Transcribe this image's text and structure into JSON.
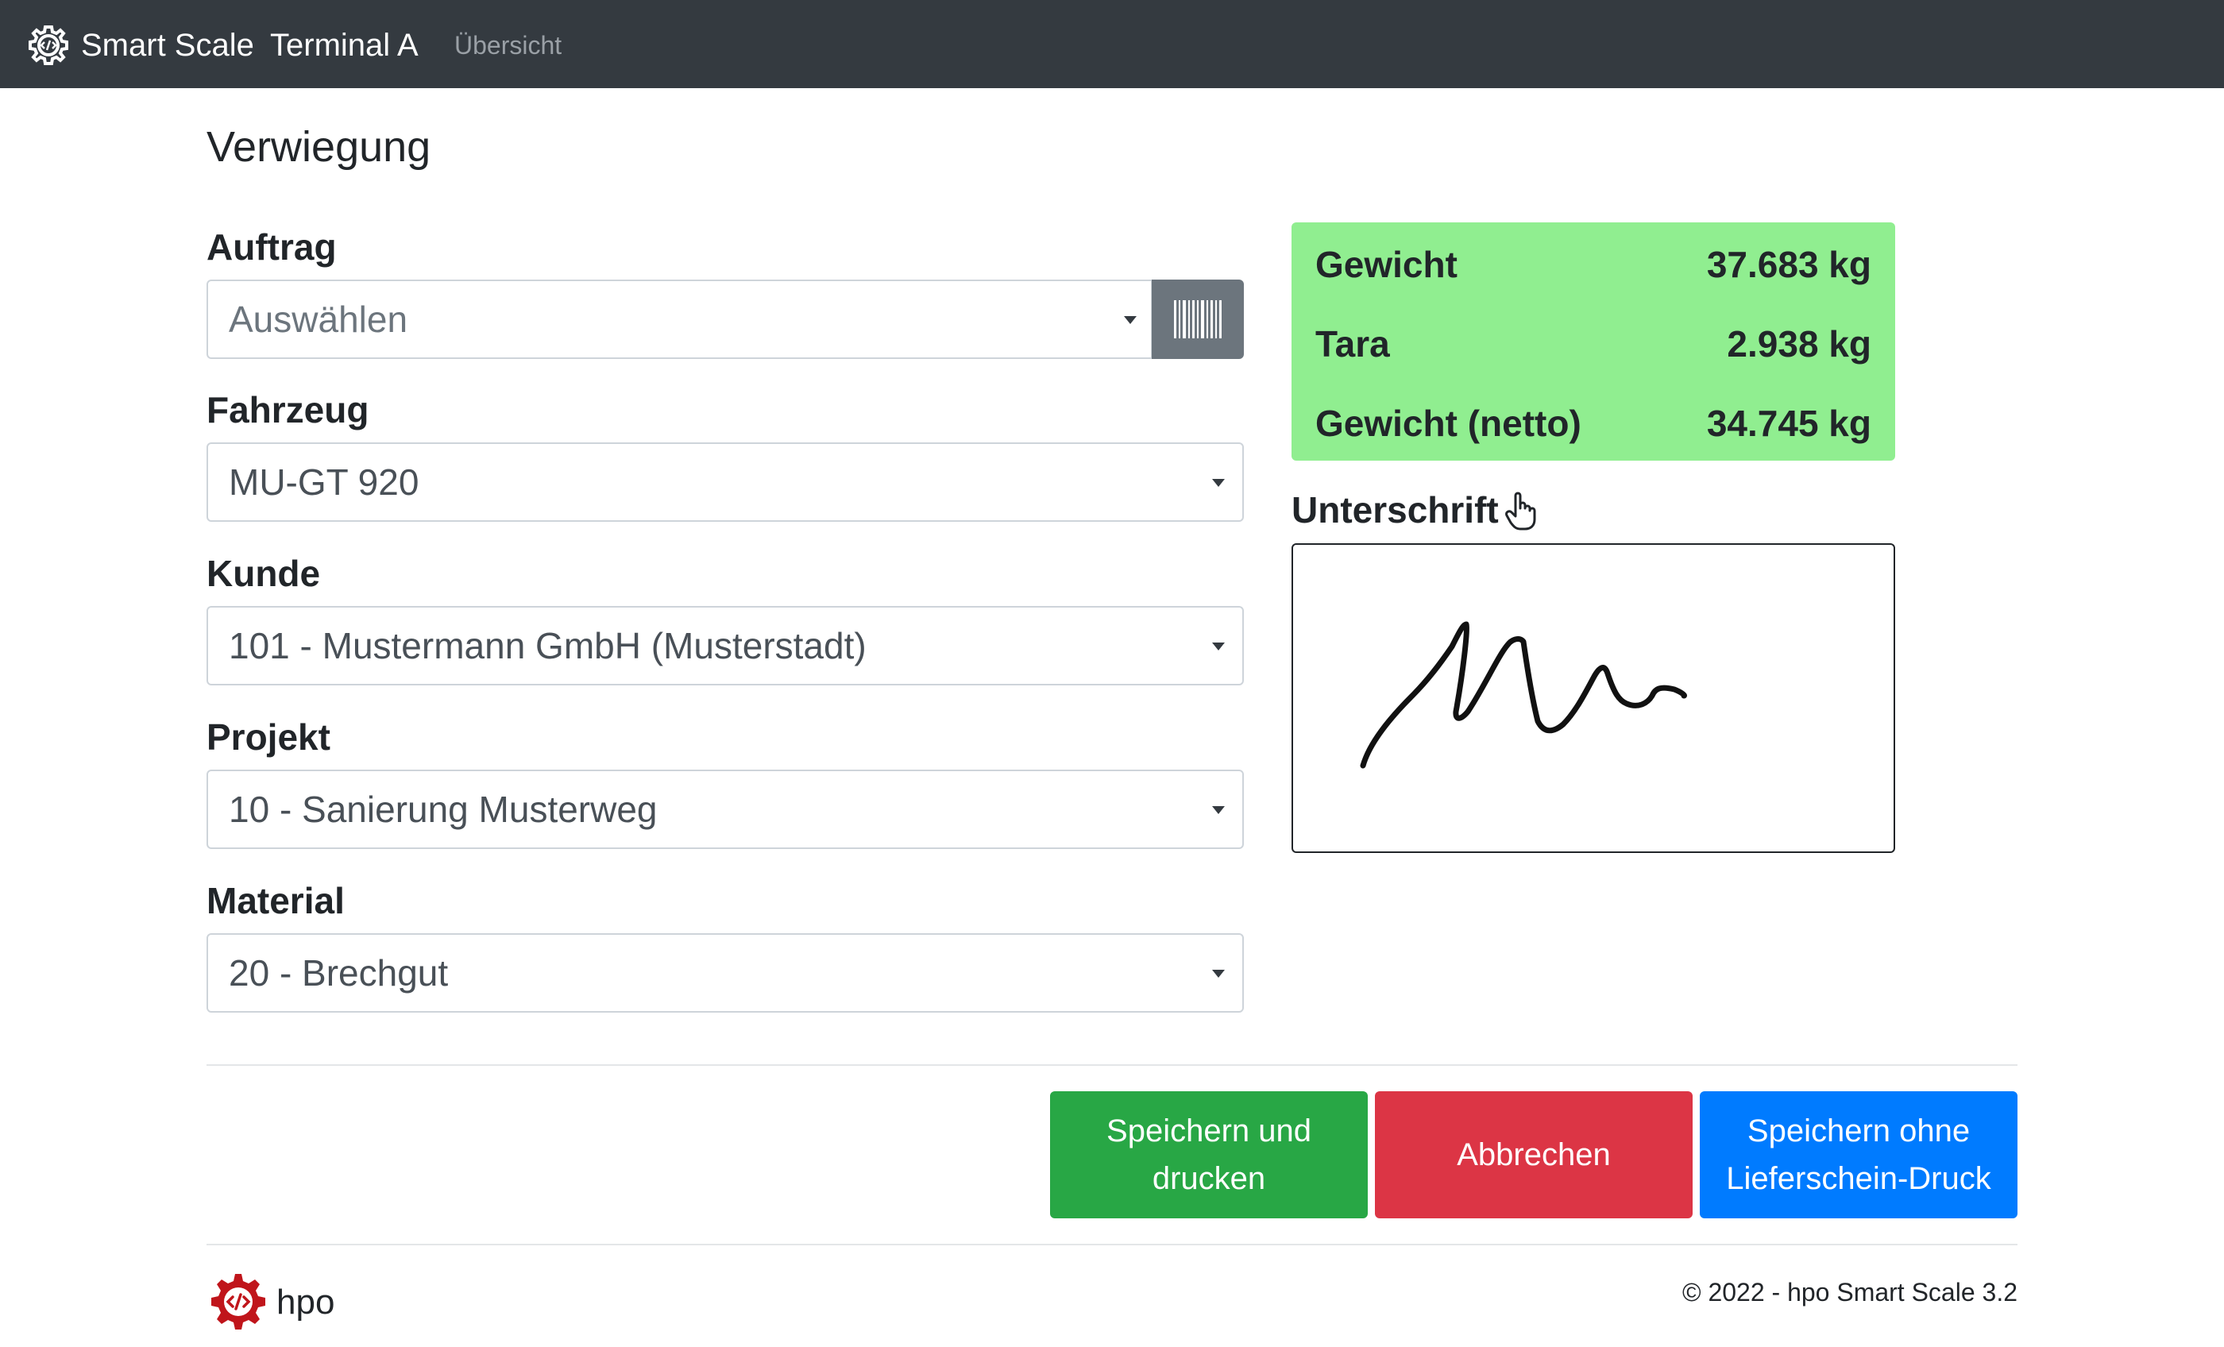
{
  "navbar": {
    "brand": "Smart Scale",
    "terminal": "Terminal A",
    "link": "Übersicht",
    "logo_icon": "gear-code-icon"
  },
  "page": {
    "title": "Verwiegung"
  },
  "form": {
    "auftrag": {
      "label": "Auftrag",
      "placeholder": "Auswählen",
      "barcode_icon": "barcode-icon"
    },
    "fahrzeug": {
      "label": "Fahrzeug",
      "value": "MU-GT 920"
    },
    "kunde": {
      "label": "Kunde",
      "value": "101 - Mustermann GmbH (Musterstadt)"
    },
    "projekt": {
      "label": "Projekt",
      "value": "10 - Sanierung Musterweg"
    },
    "material": {
      "label": "Material",
      "value": "20 - Brechgut"
    }
  },
  "weights": {
    "panel_color": "#90ee90",
    "rows": [
      {
        "label": "Gewicht",
        "value": "37.683 kg"
      },
      {
        "label": "Tara",
        "value": "2.938 kg"
      },
      {
        "label": "Gewicht (netto)",
        "value": "34.745 kg"
      }
    ]
  },
  "signature": {
    "label": "Unterschrift",
    "icon": "hand-pointer-icon"
  },
  "buttons": {
    "save_print": "Speichern und drucken",
    "cancel": "Abbrechen",
    "save_no_print": "Speichern ohne Lieferschein-Druck",
    "colors": {
      "green": "#28a745",
      "red": "#dc3545",
      "blue": "#007bff"
    }
  },
  "footer": {
    "brand": "hpo",
    "copyright": "© 2022 - hpo Smart Scale 3.2",
    "logo_color": "#c0151b"
  }
}
